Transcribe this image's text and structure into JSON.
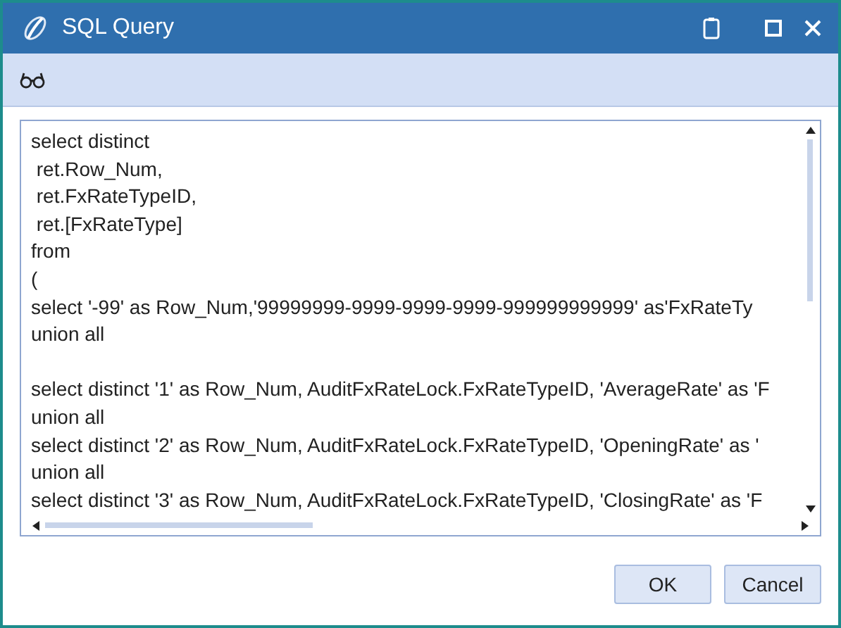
{
  "window": {
    "title": "SQL Query"
  },
  "editor": {
    "blocks": [
      [
        "select distinct",
        " ret.Row_Num,",
        " ret.FxRateTypeID,",
        " ret.[FxRateType]",
        "from",
        "(",
        "select '-99' as Row_Num,'99999999-9999-9999-9999-999999999999' as'FxRateTy",
        "union all"
      ],
      [
        "select distinct '1' as Row_Num, AuditFxRateLock.FxRateTypeID, 'AverageRate' as 'F",
        "union all",
        "select distinct '2' as Row_Num, AuditFxRateLock.FxRateTypeID, 'OpeningRate' as '",
        "union all",
        "select distinct '3' as Row_Num, AuditFxRateLock.FxRateTypeID, 'ClosingRate' as 'F"
      ]
    ]
  },
  "buttons": [
    {
      "label": "OK"
    },
    {
      "label": "Cancel"
    }
  ]
}
